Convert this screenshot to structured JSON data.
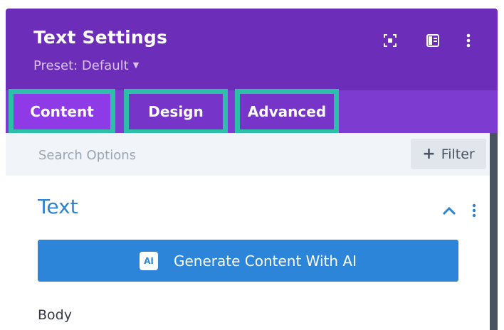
{
  "header": {
    "title": "Text Settings",
    "preset_label": "Preset: Default",
    "icons": [
      "expand-icon",
      "sidebar-layout-icon",
      "more-options-icon"
    ]
  },
  "tabs": [
    {
      "label": "Content",
      "active": true
    },
    {
      "label": "Design",
      "active": false
    },
    {
      "label": "Advanced",
      "active": false
    }
  ],
  "search": {
    "placeholder": "Search Options",
    "filter_label": "Filter"
  },
  "section": {
    "title": "Text",
    "ai_button_badge": "AI",
    "ai_button_label": "Generate Content With AI",
    "body_label": "Body"
  },
  "colors": {
    "header_bg": "#6c2eb9",
    "tabbar_bg": "#7e3bd0",
    "active_tab_bg": "#8e3ae6",
    "tab_highlight_border": "#2dbfa8",
    "accent_blue": "#2c85d9",
    "search_bg": "#f1f4f9"
  }
}
